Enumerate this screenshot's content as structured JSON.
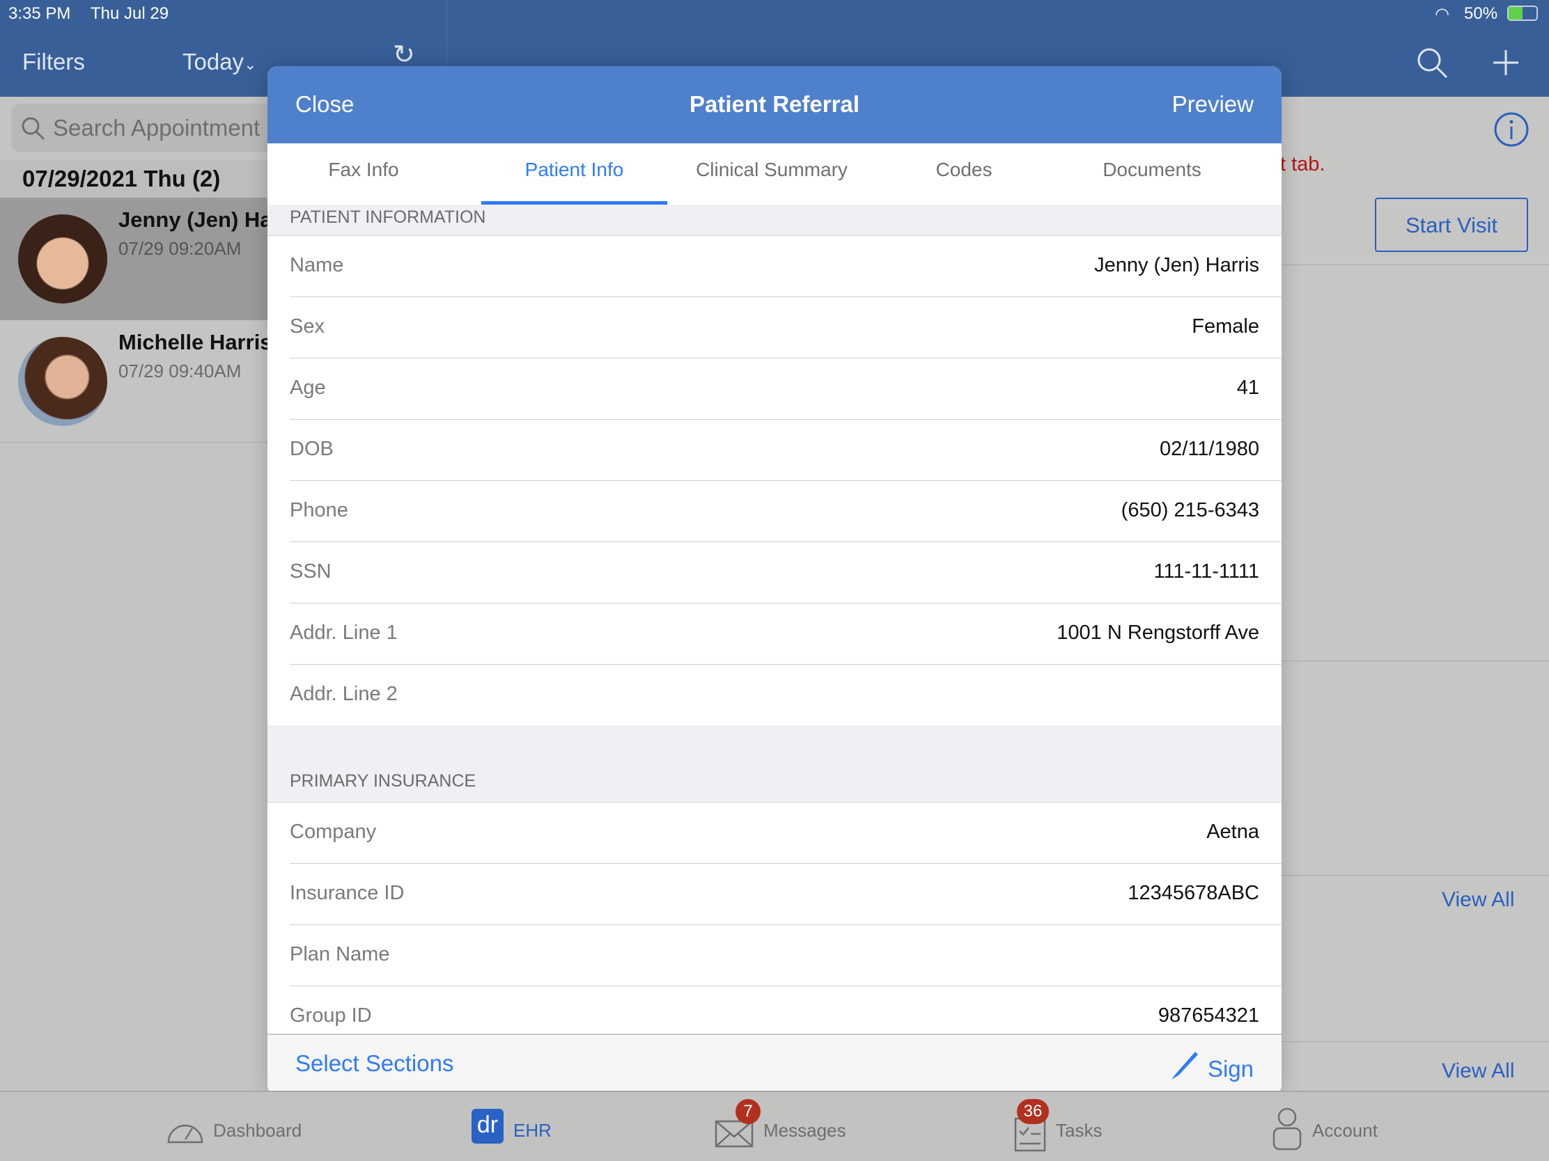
{
  "status_bar": {
    "time": "3:35 PM",
    "date": "Thu Jul 29",
    "battery": "50%"
  },
  "nav": {
    "filters": "Filters",
    "today": "Today",
    "chevron": "⌄"
  },
  "left": {
    "search_placeholder": "Search Appointment",
    "date_header": "07/29/2021 Thu (2)",
    "appointments": [
      {
        "name": "Jenny (Jen) Harris",
        "time": "07/29 09:20AM",
        "selected": true
      },
      {
        "name": "Michelle Harris",
        "time": "07/29 09:40AM",
        "selected": false
      }
    ]
  },
  "right": {
    "hint": "t tab.",
    "start_visit": "Start Visit",
    "view_all_1": "View All",
    "view_all_2": "View All"
  },
  "modal": {
    "close": "Close",
    "title": "Patient Referral",
    "preview": "Preview",
    "tabs": [
      {
        "label": "Fax Info"
      },
      {
        "label": "Patient Info",
        "active": true
      },
      {
        "label": "Clinical Summary"
      },
      {
        "label": "Codes"
      },
      {
        "label": "Documents"
      }
    ],
    "patient_section": "PATIENT INFORMATION",
    "patient_rows": [
      {
        "label": "Name",
        "value": "Jenny (Jen) Harris"
      },
      {
        "label": "Sex",
        "value": "Female"
      },
      {
        "label": "Age",
        "value": "41"
      },
      {
        "label": "DOB",
        "value": "02/11/1980"
      },
      {
        "label": "Phone",
        "value": "(650) 215-6343"
      },
      {
        "label": "SSN",
        "value": "111-11-1111"
      },
      {
        "label": "Addr. Line 1",
        "value": "1001 N Rengstorff Ave"
      },
      {
        "label": "Addr. Line 2",
        "value": ""
      }
    ],
    "insurance_section": "PRIMARY INSURANCE",
    "insurance_rows": [
      {
        "label": "Company",
        "value": "Aetna"
      },
      {
        "label": "Insurance ID",
        "value": "12345678ABC"
      },
      {
        "label": "Plan Name",
        "value": ""
      },
      {
        "label": "Group ID",
        "value": "987654321"
      }
    ],
    "select_sections": "Select Sections",
    "sign": "Sign"
  },
  "tabbar": {
    "items": [
      {
        "label": "Dashboard",
        "icon": "gauge-icon"
      },
      {
        "label": "EHR",
        "icon": "dr-logo-icon",
        "logo": "dr",
        "active": true
      },
      {
        "label": "Messages",
        "icon": "envelope-icon",
        "badge": "7"
      },
      {
        "label": "Tasks",
        "icon": "checklist-icon",
        "badge": "36"
      },
      {
        "label": "Account",
        "icon": "account-icon"
      }
    ]
  },
  "colors": {
    "nav": "#385f98",
    "modal_header": "#4f80cc",
    "accent": "#2f7bf5",
    "badge": "#b2301f",
    "hint": "#b01515"
  }
}
